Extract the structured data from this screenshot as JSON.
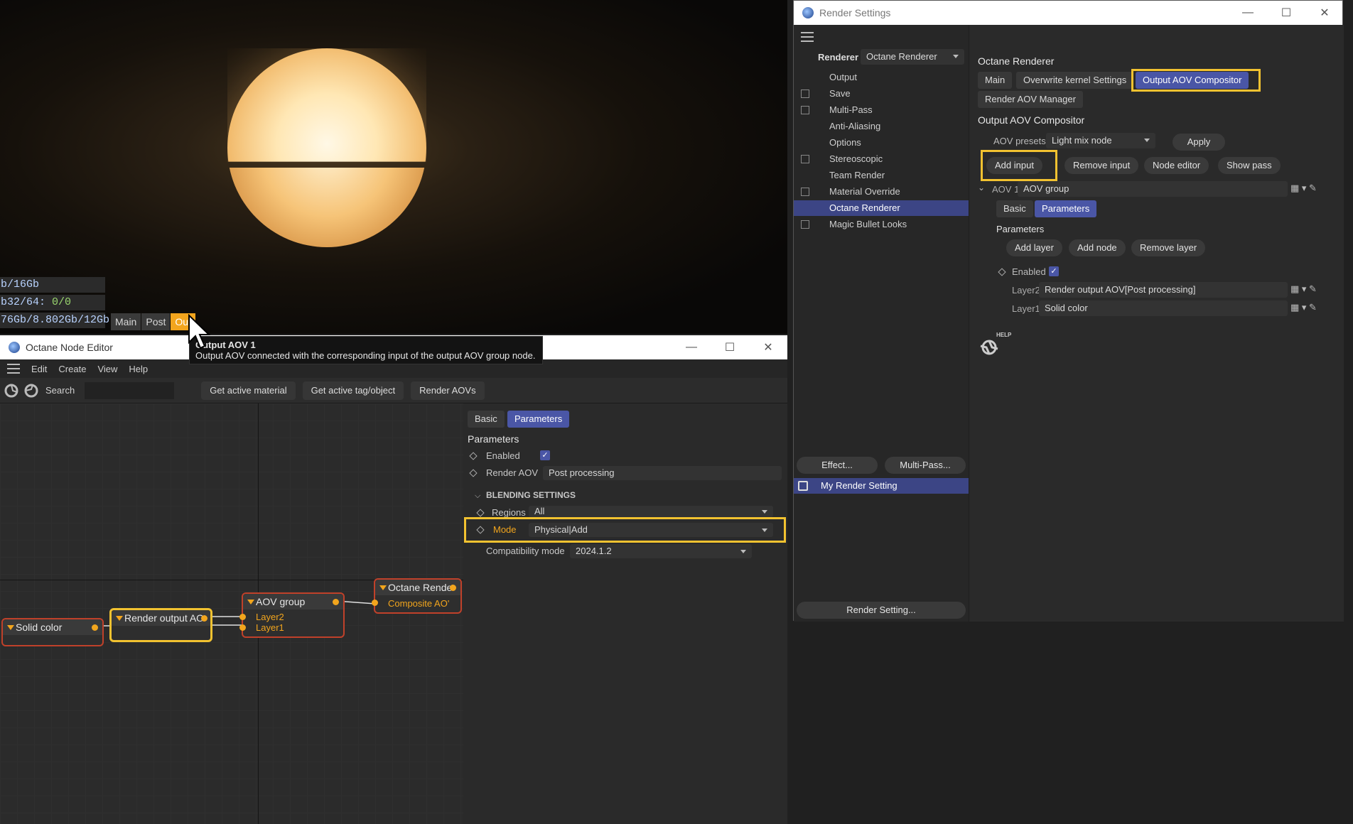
{
  "viewport": {
    "stats": [
      {
        "text": "b/16Gb",
        "green": ""
      },
      {
        "text": "b32/64: ",
        "green": "0/0"
      },
      {
        "text": "76Gb/8.802Gb/12Gb",
        "green": ""
      }
    ],
    "tabs": [
      "Main",
      "Post",
      "Out"
    ]
  },
  "node_editor": {
    "title": "Octane Node Editor",
    "menu": [
      "Edit",
      "Create",
      "View",
      "Help"
    ],
    "search_label": "Search",
    "toolbar_buttons": [
      "Get active material",
      "Get active tag/object",
      "Render AOVs"
    ],
    "nodes": {
      "solid": {
        "title": "Solid color"
      },
      "render_output": {
        "title": "Render output AO"
      },
      "aov_group": {
        "title": "AOV group",
        "pins": [
          "Layer2",
          "Layer1"
        ]
      },
      "octane": {
        "title": "Octane Rende",
        "pins": [
          "Composite AO'"
        ]
      }
    },
    "props": {
      "tabs": [
        "Basic",
        "Parameters"
      ],
      "section": "Parameters",
      "enabled_label": "Enabled",
      "render_aov_label": "Render AOV",
      "render_aov_value": "Post processing",
      "blending_header": "BLENDING SETTINGS",
      "regions_label": "Regions",
      "regions_value": "All",
      "mode_label": "Mode",
      "mode_value": "Physical|Add",
      "compat_label": "Compatibility mode",
      "compat_value": "2024.1.2"
    }
  },
  "tooltip": {
    "title": "Output AOV 1",
    "text": "Output AOV connected with the corresponding input of the output AOV group node."
  },
  "render_settings": {
    "title": "Render Settings",
    "renderer_label": "Renderer",
    "renderer_value": "Octane Renderer",
    "sidebar": [
      {
        "label": "Output",
        "checkbox": false
      },
      {
        "label": "Save",
        "checkbox": true
      },
      {
        "label": "Multi-Pass",
        "checkbox": true
      },
      {
        "label": "Anti-Aliasing",
        "checkbox": false
      },
      {
        "label": "Options",
        "checkbox": false
      },
      {
        "label": "Stereoscopic",
        "checkbox": true
      },
      {
        "label": "Team Render",
        "checkbox": false
      },
      {
        "label": "Material Override",
        "checkbox": true
      },
      {
        "label": "Octane Renderer",
        "checkbox": false
      },
      {
        "label": "Magic Bullet Looks",
        "checkbox": true
      }
    ],
    "effect_button": "Effect...",
    "multipass_button": "Multi-Pass...",
    "preset_name": "My Render Setting",
    "render_setting_button": "Render Setting...",
    "main": {
      "header": "Octane Renderer",
      "tabs": [
        "Main",
        "Overwrite kernel Settings",
        "Output AOV Compositor",
        "Render AOV Manager"
      ],
      "section": "Output AOV Compositor",
      "presets_label": "AOV presets",
      "presets_value": "Light mix node",
      "apply": "Apply",
      "buttons": [
        "Add input",
        "Remove input",
        "Node editor",
        "Show pass"
      ],
      "aov_label": "AOV 1",
      "aov_value": "AOV group",
      "sub_tabs": [
        "Basic",
        "Parameters"
      ],
      "params_header": "Parameters",
      "layer_buttons": [
        "Add layer",
        "Add node",
        "Remove layer"
      ],
      "enabled_label": "Enabled",
      "layers": [
        {
          "label": "Layer2",
          "value": "Render output AOV[Post processing]"
        },
        {
          "label": "Layer1",
          "value": "Solid color"
        }
      ],
      "help_label": "HELP"
    }
  },
  "colors": {
    "accent": "#4a56a6",
    "highlight": "#f2c230",
    "node_orange": "#f2a51d",
    "node_red": "#c0412a"
  }
}
